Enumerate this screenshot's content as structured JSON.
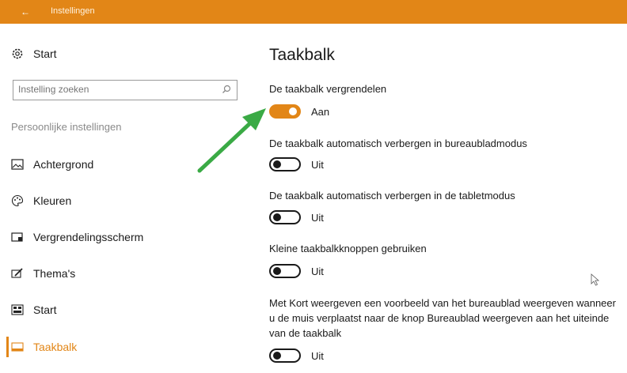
{
  "titlebar": {
    "back_glyph": "←",
    "title": "Instellingen",
    "color": "#e28617"
  },
  "sidebar": {
    "home_label": "Start",
    "search_placeholder": "Instelling zoeken",
    "section_label": "Persoonlijke instellingen",
    "items": [
      {
        "icon": "image-icon",
        "label": "Achtergrond"
      },
      {
        "icon": "palette-icon",
        "label": "Kleuren"
      },
      {
        "icon": "lockscreen-icon",
        "label": "Vergrendelingsscherm"
      },
      {
        "icon": "brush-icon",
        "label": "Thema's"
      },
      {
        "icon": "start-icon",
        "label": "Start"
      },
      {
        "icon": "taskbar-icon",
        "label": "Taakbalk",
        "active": true
      }
    ]
  },
  "main": {
    "title": "Taakbalk",
    "settings": [
      {
        "label": "De taakbalk vergrendelen",
        "state": true,
        "state_text": "Aan"
      },
      {
        "label": "De taakbalk automatisch verbergen in bureaubladmodus",
        "state": false,
        "state_text": "Uit"
      },
      {
        "label": "De taakbalk automatisch verbergen in de tabletmodus",
        "state": false,
        "state_text": "Uit"
      },
      {
        "label": "Kleine taakbalkknoppen gebruiken",
        "state": false,
        "state_text": "Uit"
      },
      {
        "label": "Met Kort weergeven een voorbeeld van het bureaublad weergeven wanneer u de muis verplaatst naar de knop Bureaublad weergeven aan het uiteinde van de taakbalk",
        "state": false,
        "state_text": "Uit"
      }
    ]
  },
  "colors": {
    "accent": "#e28617",
    "annotation_arrow": "#3aaa45"
  }
}
